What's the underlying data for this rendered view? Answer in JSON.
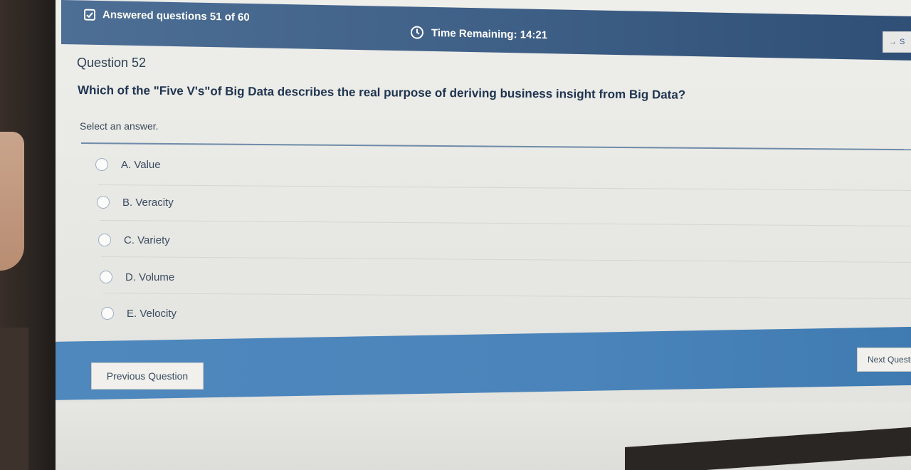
{
  "header": {
    "answered_text": "Answered questions 51 of 60",
    "timer_text": "Time Remaining: 14:21",
    "side_button_label": "S"
  },
  "question": {
    "number_label": "Question 52",
    "text": "Which of the \"Five V's\"of Big Data describes the real purpose of deriving business insight from Big Data?",
    "instruction": "Select an answer."
  },
  "options": [
    {
      "label": "A. Value"
    },
    {
      "label": "B. Veracity"
    },
    {
      "label": "C. Variety"
    },
    {
      "label": "D. Volume"
    },
    {
      "label": "E. Velocity"
    }
  ],
  "footer": {
    "previous_label": "Previous Question",
    "next_label": "Next Questi"
  },
  "colors": {
    "header_bg": "#3f6087",
    "footer_bg": "#4a84ba",
    "text_primary": "#1f3450"
  },
  "icons": {
    "answered": "checkbox-icon",
    "timer": "clock-icon",
    "side": "arrow-right-icon"
  }
}
